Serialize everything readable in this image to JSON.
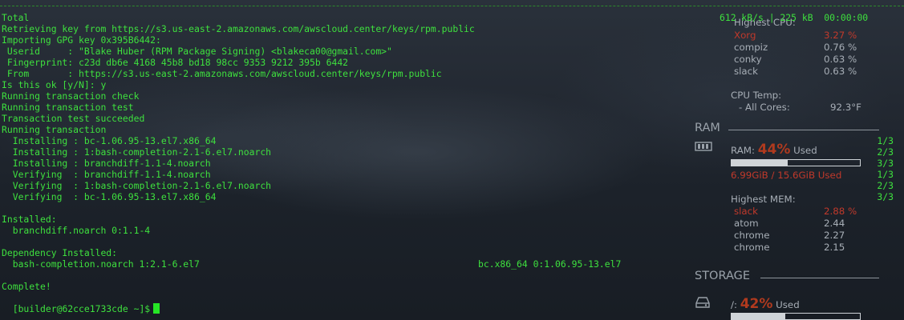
{
  "terminal": {
    "lines": [
      "Total",
      "Retrieving key from https://s3.us-east-2.amazonaws.com/awscloud.center/keys/rpm.public",
      "Importing GPG key 0x395B6442:",
      " Userid     : \"Blake Huber (RPM Package Signing) <blakeca00@gmail.com>\"",
      " Fingerprint: c23d db6e 4168 45b8 bd18 98cc 9353 9212 395b 6442",
      " From       : https://s3.us-east-2.amazonaws.com/awscloud.center/keys/rpm.public",
      "Is this ok [y/N]: y",
      "Running transaction check",
      "Running transaction test",
      "Transaction test succeeded",
      "Running transaction",
      "  Installing : bc-1.06.95-13.el7.x86_64",
      "  Installing : 1:bash-completion-2.1-6.el7.noarch",
      "  Installing : branchdiff-1.1-4.noarch",
      "  Verifying  : branchdiff-1.1-4.noarch",
      "  Verifying  : 1:bash-completion-2.1-6.el7.noarch",
      "  Verifying  : bc-1.06.95-13.el7.x86_64",
      "",
      "Installed:",
      "  branchdiff.noarch 0:1.1-4",
      "",
      "Dependency Installed:",
      "  bash-completion.noarch 1:2.1-6.el7",
      "",
      "Complete!"
    ],
    "dependency_second": "bc.x86_64 0:1.06.95-13.el7",
    "total_stats": "612 kB/s | 225 kB  00:00:00",
    "progress_counts": [
      "1/3",
      "2/3",
      "3/3",
      "1/3",
      "2/3",
      "3/3"
    ],
    "prompt": "[builder@62cce1733cde ~]$"
  },
  "conky": {
    "cpu_header": "Highest CPU:",
    "cpu_processes": [
      {
        "name": "Xorg",
        "value": "3.27 %",
        "hot": true
      },
      {
        "name": "compiz",
        "value": "0.76 %",
        "hot": false
      },
      {
        "name": "conky",
        "value": "0.63 %",
        "hot": false
      },
      {
        "name": "slack",
        "value": "0.63 %",
        "hot": false
      }
    ],
    "cpu_temp_label": "CPU Temp:",
    "cpu_temp_cores_label": "- All Cores:",
    "cpu_temp_value": "92.3°F",
    "ram_section": "RAM",
    "ram_label": "RAM:",
    "ram_percent": "44%",
    "ram_used_word": "Used",
    "ram_fraction": 0.44,
    "ram_detail": "6.99GiB / 15.6GiB Used",
    "mem_header": "Highest MEM:",
    "mem_processes": [
      {
        "name": "slack",
        "value": "2.88 %",
        "hot": true
      },
      {
        "name": "atom",
        "value": "2.44",
        "hot": false
      },
      {
        "name": "chrome",
        "value": "2.27",
        "hot": false
      },
      {
        "name": "chrome",
        "value": "2.15",
        "hot": false
      }
    ],
    "storage_section": "STORAGE",
    "storage_mount": "/:",
    "storage_percent": "42%",
    "storage_used_word": "Used",
    "storage_fraction": 0.42
  },
  "colors": {
    "terminal_text": "#3ee03e",
    "hot": "#c0392b",
    "percent": "#b03a1e"
  },
  "icons": {
    "ram": "memory-chip-icon",
    "storage": "hard-drive-icon"
  }
}
